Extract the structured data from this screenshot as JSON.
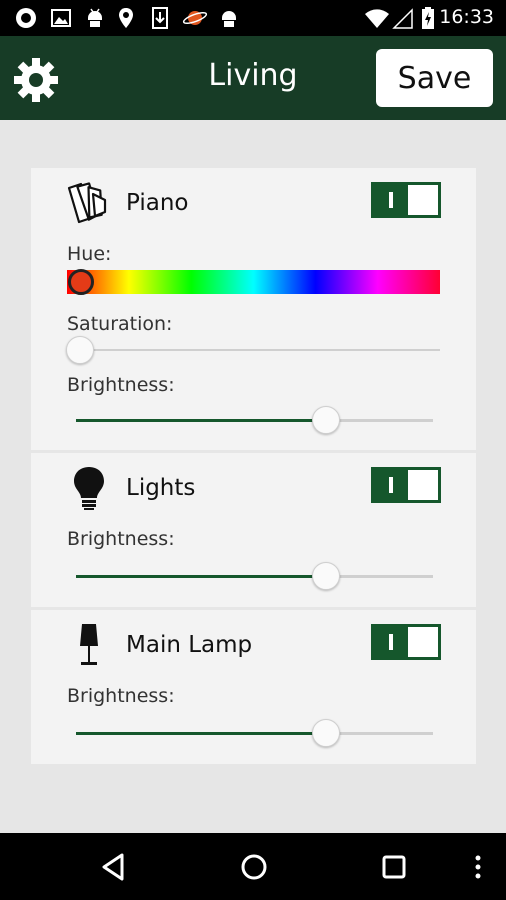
{
  "status_bar": {
    "time": "16:33",
    "icons": [
      "circle-icon",
      "image-icon",
      "android-icon",
      "location-icon",
      "download-icon",
      "planet-icon",
      "android-icon",
      "wifi-icon",
      "signal-icon",
      "battery-charging-icon"
    ]
  },
  "header": {
    "title": "Living",
    "save_label": "Save",
    "settings_icon": "gear-icon"
  },
  "lights": [
    {
      "name": "Piano",
      "icon": "light-strip-icon",
      "on": true,
      "toggle_label": "I",
      "hue_label": "Hue:",
      "hue": 0.03,
      "saturation_label": "Saturation:",
      "saturation": 0.0,
      "brightness_label": "Brightness:",
      "brightness": 0.7
    },
    {
      "name": "Lights",
      "icon": "bulb-icon",
      "on": true,
      "toggle_label": "I",
      "brightness_label": "Brightness:",
      "brightness": 0.7
    },
    {
      "name": "Main Lamp",
      "icon": "table-lamp-icon",
      "on": true,
      "toggle_label": "I",
      "brightness_label": "Brightness:",
      "brightness": 0.7
    }
  ],
  "nav_bar": {
    "icons": [
      "back-icon",
      "home-icon",
      "recents-icon",
      "overflow-menu-icon"
    ]
  },
  "colors": {
    "accent": "#15572c",
    "header_bg": "#173c26",
    "card_bg": "#f3f3f3",
    "page_bg": "#e6e6e6"
  }
}
